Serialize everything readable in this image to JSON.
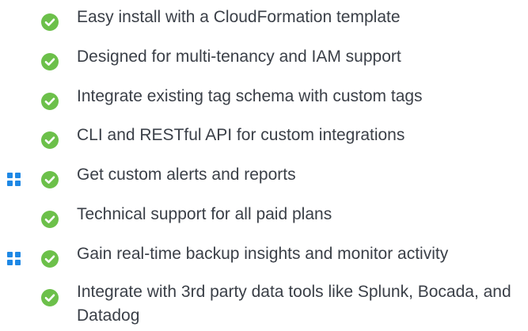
{
  "colors": {
    "check": "#6cc04a",
    "handle": "#1e88e5",
    "text": "#3a3f47"
  },
  "features": [
    {
      "text": "Easy install with a CloudFormation template",
      "icon": "check-circle-icon",
      "draggable": false
    },
    {
      "text": "Designed for multi-tenancy and IAM support",
      "icon": "check-circle-icon",
      "draggable": false
    },
    {
      "text": "Integrate existing tag schema with custom tags",
      "icon": "check-circle-icon",
      "draggable": false
    },
    {
      "text": "CLI and RESTful API for custom integrations",
      "icon": "check-circle-icon",
      "draggable": false
    },
    {
      "text": "Get custom alerts and reports",
      "icon": "check-circle-icon",
      "draggable": true
    },
    {
      "text": "Technical support for all paid plans",
      "icon": "check-circle-icon",
      "draggable": false
    },
    {
      "text": "Gain real-time backup insights and monitor activity",
      "icon": "check-circle-icon",
      "draggable": true
    },
    {
      "text": "Integrate with 3rd party data tools like Splunk, Bocada, and Datadog",
      "icon": "check-circle-icon",
      "draggable": false
    }
  ]
}
